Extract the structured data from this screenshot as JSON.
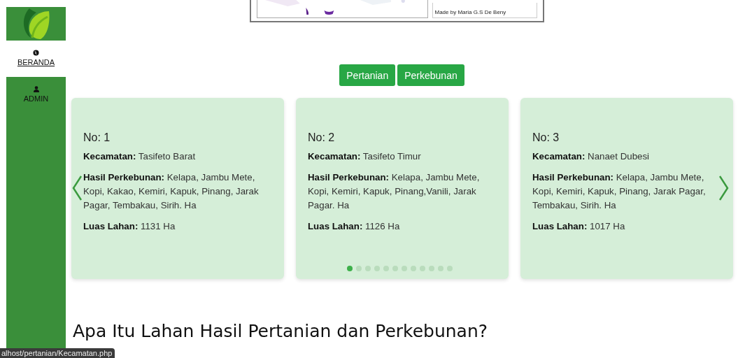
{
  "sidebar": {
    "items": [
      {
        "label": "BERANDA",
        "selected": true
      },
      {
        "label": "ADMIN",
        "selected": false
      }
    ]
  },
  "map_inset": {
    "credit": "Made by Maria G.S De Beny"
  },
  "category_buttons": [
    "Pertanian",
    "Perkebunan"
  ],
  "cards": [
    {
      "title": "No: 1",
      "fields": [
        "**Kecamatan:** Tasifeto Barat",
        "**Hasil Perkebunan:** Kelapa, Jambu Mete, Kopi, Kakao, Kemiri, Kapuk, Pinang, Jarak Pagar, Tembakau, Sirih. Ha",
        "**Luas Lahan:** 1131 Ha"
      ]
    },
    {
      "title": "No: 2",
      "fields": [
        "**Kecamatan:** Tasifeto Timur",
        "**Hasil Perkebunan:** Kelapa, Jambu Mete, Kopi, Kemiri, Kapuk, Pinang,Vanili, Jarak Pagar. Ha",
        "**Luas Lahan:** 1126 Ha"
      ]
    },
    {
      "title": "No: 3",
      "fields": [
        "**Kecamatan:** Nanaet Dubesi",
        "**Hasil Perkebunan:** Kelapa, Jambu Mete, Kopi, Kemiri, Kapuk, Pinang, Jarak Pagar, Tembakau, Sirih. Ha",
        "**Luas Lahan:** 1017 Ha"
      ]
    }
  ],
  "pagination": [
    {
      "selected": true
    },
    {
      "selected": false
    },
    {
      "selected": false
    },
    {
      "selected": false
    },
    {
      "selected": false
    },
    {
      "selected": false
    },
    {
      "selected": false
    },
    {
      "selected": false
    },
    {
      "selected": false
    },
    {
      "selected": false
    },
    {
      "selected": false
    },
    {
      "selected": false
    }
  ],
  "heading": "Apa Itu Lahan Hasil Pertanian dan Perkebunan?",
  "status_bar": "alhost/pertanian/Kecamatan.php"
}
